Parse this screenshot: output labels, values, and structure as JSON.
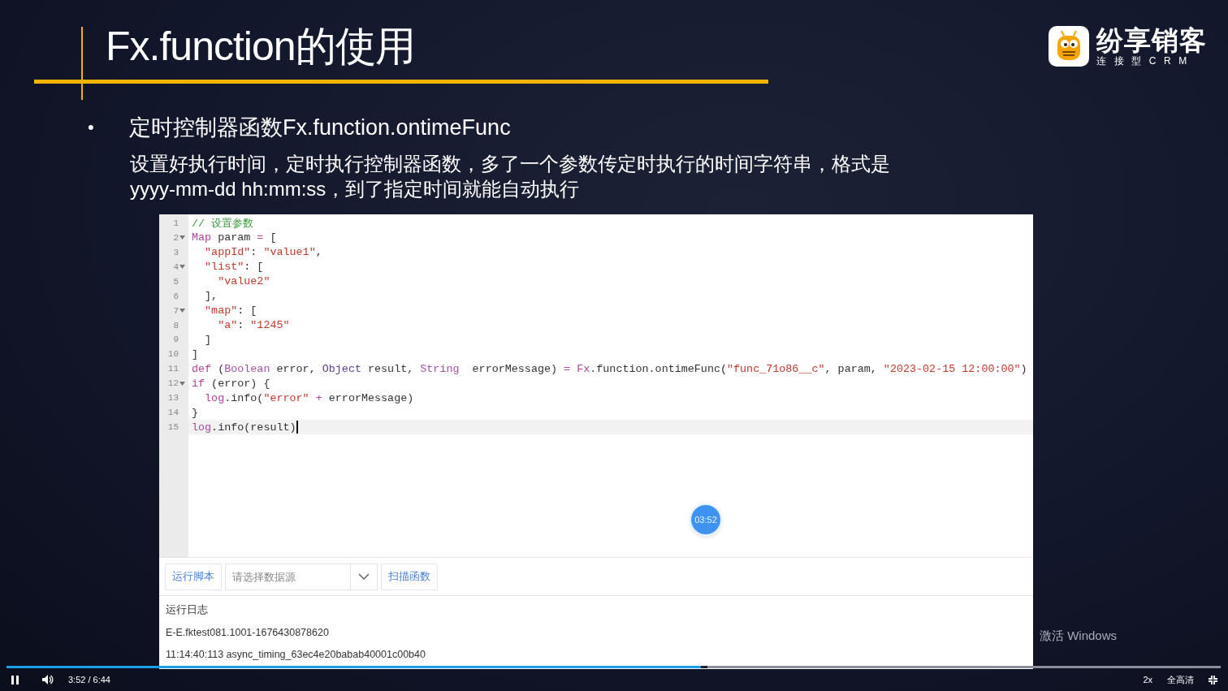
{
  "slide": {
    "title": "Fx.function的使用",
    "logo": {
      "name": "纷享销客",
      "tagline": "连接型CRM"
    },
    "bullet": {
      "marker": "•",
      "text": "定时控制器函数Fx.function.ontimeFunc"
    },
    "description": "设置好执行时间，定时执行控制器函数，多了一个参数传定时执行的时间字符串，格式是yyyy-mm-dd hh:mm:ss，到了指定时间就能自动执行"
  },
  "editor": {
    "lines": [
      {
        "number": "1",
        "fold": false,
        "active": false,
        "tokens": [
          {
            "kind": "comment",
            "text": "// 设置参数"
          }
        ]
      },
      {
        "number": "2",
        "fold": true,
        "active": false,
        "tokens": [
          {
            "kind": "keyword",
            "text": "Map"
          },
          {
            "kind": "plain",
            "text": " param "
          },
          {
            "kind": "operator",
            "text": "="
          },
          {
            "kind": "plain",
            "text": " ["
          }
        ]
      },
      {
        "number": "3",
        "fold": false,
        "active": false,
        "tokens": [
          {
            "kind": "string",
            "text": "  \"appId\""
          },
          {
            "kind": "plain",
            "text": ": "
          },
          {
            "kind": "string",
            "text": "\"value1\""
          },
          {
            "kind": "plain",
            "text": ","
          }
        ]
      },
      {
        "number": "4",
        "fold": true,
        "active": false,
        "tokens": [
          {
            "kind": "string",
            "text": "  \"list\""
          },
          {
            "kind": "plain",
            "text": ": ["
          }
        ]
      },
      {
        "number": "5",
        "fold": false,
        "active": false,
        "tokens": [
          {
            "kind": "string",
            "text": "    \"value2\""
          }
        ]
      },
      {
        "number": "6",
        "fold": false,
        "active": false,
        "tokens": [
          {
            "kind": "plain",
            "text": "  ],"
          }
        ]
      },
      {
        "number": "7",
        "fold": true,
        "active": false,
        "tokens": [
          {
            "kind": "string",
            "text": "  \"map\""
          },
          {
            "kind": "plain",
            "text": ": ["
          }
        ]
      },
      {
        "number": "8",
        "fold": false,
        "active": false,
        "tokens": [
          {
            "kind": "string",
            "text": "    \"a\""
          },
          {
            "kind": "plain",
            "text": ": "
          },
          {
            "kind": "string",
            "text": "\"1245\""
          }
        ]
      },
      {
        "number": "9",
        "fold": false,
        "active": false,
        "tokens": [
          {
            "kind": "plain",
            "text": "  ]"
          }
        ]
      },
      {
        "number": "10",
        "fold": false,
        "active": false,
        "tokens": [
          {
            "kind": "plain",
            "text": "]"
          }
        ]
      },
      {
        "number": "11",
        "fold": false,
        "active": false,
        "tokens": [
          {
            "kind": "keyword",
            "text": "def"
          },
          {
            "kind": "plain",
            "text": " ("
          },
          {
            "kind": "type",
            "text": "Boolean"
          },
          {
            "kind": "plain",
            "text": " error, "
          },
          {
            "kind": "class",
            "text": "Object"
          },
          {
            "kind": "plain",
            "text": " result, "
          },
          {
            "kind": "type",
            "text": "String"
          },
          {
            "kind": "plain",
            "text": "  errorMessage) "
          },
          {
            "kind": "operator",
            "text": "="
          },
          {
            "kind": "keyword",
            "text": " Fx"
          },
          {
            "kind": "plain",
            "text": ".function.ontimeFunc("
          },
          {
            "kind": "string",
            "text": "\"func_71o86__c\""
          },
          {
            "kind": "plain",
            "text": ", param, "
          },
          {
            "kind": "string",
            "text": "\"2023-02-15 12:00:00\""
          },
          {
            "kind": "plain",
            "text": ")"
          }
        ]
      },
      {
        "number": "12",
        "fold": true,
        "active": false,
        "tokens": [
          {
            "kind": "keyword",
            "text": "if"
          },
          {
            "kind": "plain",
            "text": " (error) {"
          }
        ]
      },
      {
        "number": "13",
        "fold": false,
        "active": false,
        "tokens": [
          {
            "kind": "keyword",
            "text": "  log"
          },
          {
            "kind": "plain",
            "text": ".info("
          },
          {
            "kind": "string",
            "text": "\"error\""
          },
          {
            "kind": "operator",
            "text": " +"
          },
          {
            "kind": "plain",
            "text": " errorMessage)"
          }
        ]
      },
      {
        "number": "14",
        "fold": false,
        "active": false,
        "tokens": [
          {
            "kind": "plain",
            "text": "}"
          }
        ]
      },
      {
        "number": "15",
        "fold": false,
        "active": true,
        "tokens": [
          {
            "kind": "keyword",
            "text": "log"
          },
          {
            "kind": "plain",
            "text": ".info(result)"
          }
        ]
      }
    ],
    "timer_badge": "03:52",
    "toolbar": {
      "run_button": "运行脚本",
      "data_source": {
        "placeholder": "请选择数据源"
      },
      "scan_button": "扫描函数"
    },
    "log": {
      "title": "运行日志",
      "entries": [
        "E-E.fktest081.1001-1676430878620",
        "11:14:40:113 async_timing_63ec4e20babab40001c00b40"
      ]
    }
  },
  "os_notice": "激活 Windows",
  "player": {
    "playing": true,
    "level": 0.572,
    "time": "3:52 / 6:44",
    "speed": "2x",
    "quality": "全高清"
  }
}
